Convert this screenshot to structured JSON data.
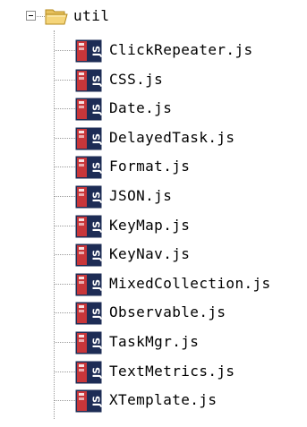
{
  "tree": {
    "folder": {
      "label": "util",
      "icon": "folder-open-icon",
      "expander": "minus",
      "expanded": true
    },
    "files": [
      {
        "label": "ClickRepeater.js",
        "icon": "js-file-icon"
      },
      {
        "label": "CSS.js",
        "icon": "js-file-icon"
      },
      {
        "label": "Date.js",
        "icon": "js-file-icon"
      },
      {
        "label": "DelayedTask.js",
        "icon": "js-file-icon"
      },
      {
        "label": "Format.js",
        "icon": "js-file-icon"
      },
      {
        "label": "JSON.js",
        "icon": "js-file-icon"
      },
      {
        "label": "KeyMap.js",
        "icon": "js-file-icon"
      },
      {
        "label": "KeyNav.js",
        "icon": "js-file-icon"
      },
      {
        "label": "MixedCollection.js",
        "icon": "js-file-icon"
      },
      {
        "label": "Observable.js",
        "icon": "js-file-icon"
      },
      {
        "label": "TaskMgr.js",
        "icon": "js-file-icon"
      },
      {
        "label": "TextMetrics.js",
        "icon": "js-file-icon"
      },
      {
        "label": "XTemplate.js",
        "icon": "js-file-icon"
      }
    ]
  },
  "colors": {
    "js_icon_red": "#c8363a",
    "js_icon_dark": "#1d2c55",
    "folder_yellow": "#f5d57a",
    "tree_line": "#9a9a9a"
  }
}
